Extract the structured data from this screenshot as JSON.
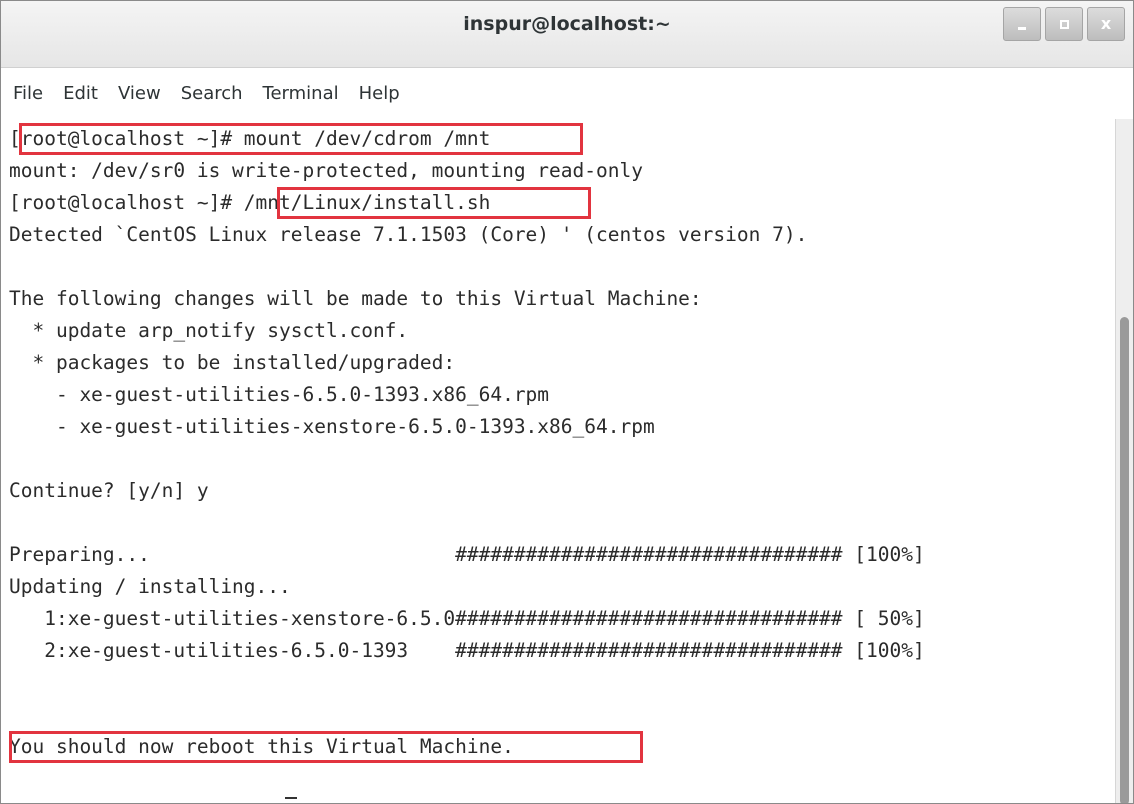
{
  "window": {
    "title": "inspur@localhost:~"
  },
  "window_controls": {
    "minimize_icon": "minimize-icon",
    "maximize_icon": "maximize-icon",
    "close_icon": "close-icon",
    "close_glyph": "x"
  },
  "menu": {
    "items": [
      "File",
      "Edit",
      "View",
      "Search",
      "Terminal",
      "Help"
    ]
  },
  "terminal": {
    "lines": [
      "[root@localhost ~]# mount /dev/cdrom /mnt",
      "mount: /dev/sr0 is write-protected, mounting read-only",
      "[root@localhost ~]# /mnt/Linux/install.sh",
      "Detected `CentOS Linux release 7.1.1503 (Core) ' (centos version 7).",
      "",
      "The following changes will be made to this Virtual Machine:",
      "  * update arp_notify sysctl.conf.",
      "  * packages to be installed/upgraded:",
      "    - xe-guest-utilities-6.5.0-1393.x86_64.rpm",
      "    - xe-guest-utilities-xenstore-6.5.0-1393.x86_64.rpm",
      "",
      "Continue? [y/n] y",
      "",
      "Preparing...                          ################################# [100%]",
      "Updating / installing...",
      "   1:xe-guest-utilities-xenstore-6.5.0################################# [ 50%]",
      "   2:xe-guest-utilities-6.5.0-1393    ################################# [100%]",
      "",
      "You should now reboot this Virtual Machine."
    ]
  },
  "annotations": {
    "color": "#e2343f"
  },
  "colors": {
    "text": "#2b2b2b",
    "background": "#ffffff",
    "titlebar": "#e6e6e6"
  }
}
